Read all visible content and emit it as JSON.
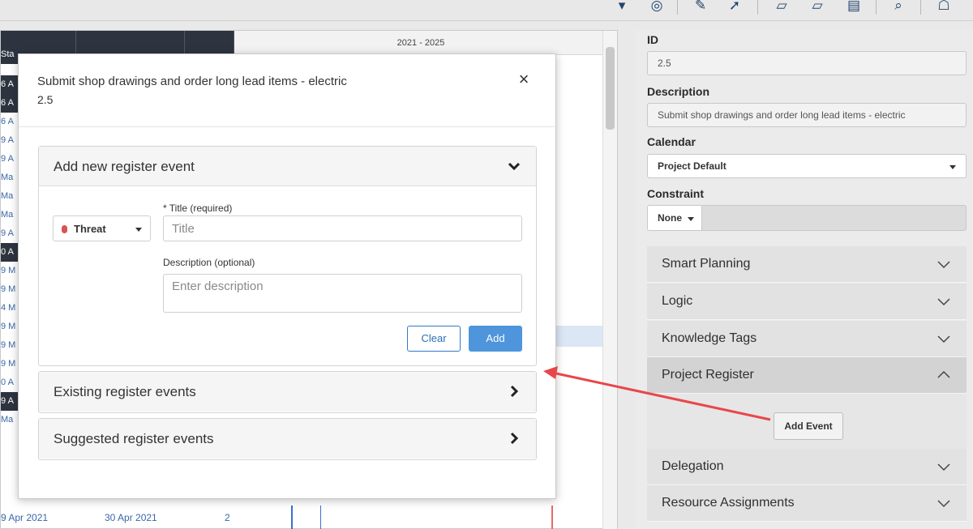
{
  "gantt": {
    "timeline_label": "2021 - 2025",
    "left_fragments": [
      "Sta",
      "6 A",
      "6 A",
      "6 A",
      "9 A",
      "9 A",
      "Ma",
      "Ma",
      "Ma",
      "9 A",
      "0 A",
      "9 M",
      "9 M",
      "4 M",
      "9 M",
      "9 M",
      "9 M",
      "0 A",
      "9 A",
      "Ma"
    ],
    "bottom_row": {
      "start": "9 Apr 2021",
      "finish": "30 Apr 2021",
      "duration": "2"
    }
  },
  "panel": {
    "id_label": "ID",
    "id_value": "2.5",
    "description_label": "Description",
    "description_value": "Submit shop drawings and order long lead items - electric",
    "calendar_label": "Calendar",
    "calendar_value": "Project Default",
    "constraint_label": "Constraint",
    "constraint_value": "None",
    "sections": [
      {
        "label": "Smart Planning"
      },
      {
        "label": "Logic"
      },
      {
        "label": "Knowledge Tags"
      },
      {
        "label": "Project Register"
      },
      {
        "label": "Delegation"
      },
      {
        "label": "Resource Assignments"
      }
    ],
    "add_event_label": "Add Event"
  },
  "modal": {
    "title": "Submit shop drawings and order long lead items - electric",
    "subtitle": "2.5",
    "new_event": {
      "header": "Add new register event",
      "type_value": "Threat",
      "title_label": "* Title (required)",
      "title_placeholder": "Title",
      "description_label": "Description (optional)",
      "description_placeholder": "Enter description",
      "clear_label": "Clear",
      "add_label": "Add"
    },
    "existing_header": "Existing register events",
    "suggested_header": "Suggested register events"
  },
  "colors": {
    "accent_blue": "#4e95dc",
    "threat_red": "#d9534f",
    "annotation_arrow": "#e8474a",
    "toolbar_icon": "#23456d"
  },
  "icons": {
    "toolbar": [
      "filter-icon",
      "globe-icon",
      "magic-wand-icon",
      "pin-icon",
      "note-icon",
      "note-edit-icon",
      "print-icon",
      "search-icon",
      "bulb-icon"
    ]
  }
}
